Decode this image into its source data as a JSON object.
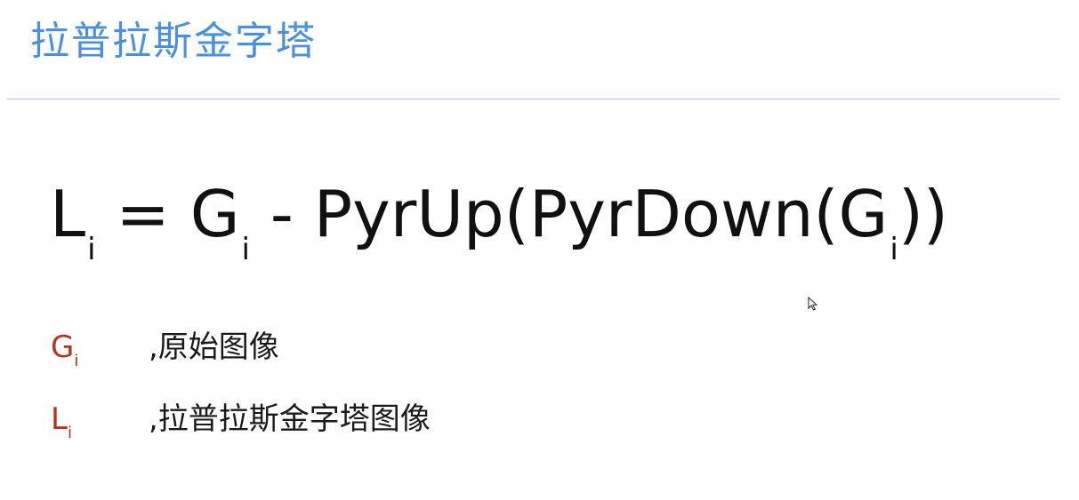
{
  "slide": {
    "title": "拉普拉斯金字塔"
  },
  "formula": {
    "lhs_symbol": "L",
    "lhs_sub": "i",
    "equals": "=",
    "g_symbol": "G",
    "g_sub": "i",
    "minus": "-",
    "func_text": "PyrUp(PyrDown(G",
    "inner_sub": "i",
    "closing": "))"
  },
  "legend": [
    {
      "symbol": "G",
      "sub": "i",
      "text": ",原始图像"
    },
    {
      "symbol": "L",
      "sub": "i",
      "text": ",拉普拉斯金字塔图像"
    }
  ],
  "colors": {
    "title": "#4a8fe0",
    "rule": "#a7c3ea",
    "symbol": "#b8321f",
    "text": "#111111"
  },
  "cursor": {
    "icon": "mouse-pointer-icon"
  }
}
